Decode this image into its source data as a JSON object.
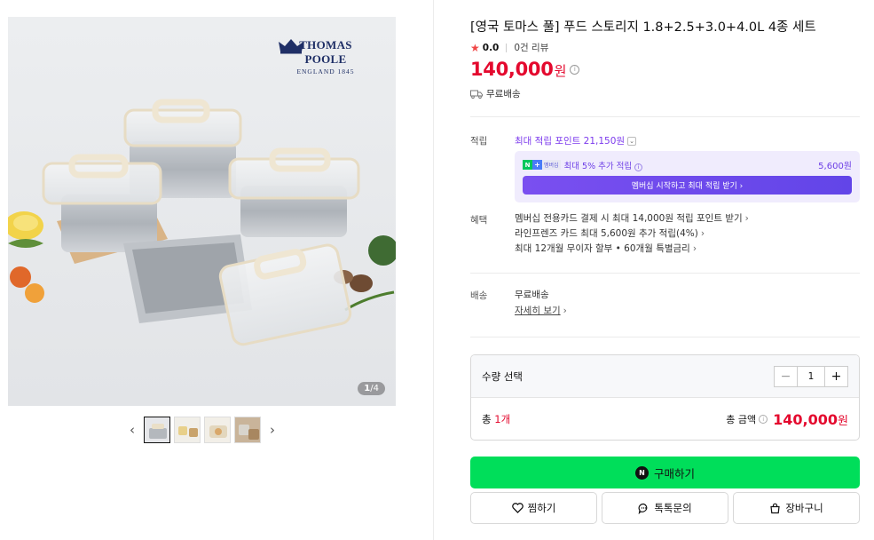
{
  "gallery": {
    "brand_name": "THOMAS POOLE",
    "brand_sub": "ENGLAND 1845",
    "counter_current": "1",
    "counter_total": "/4",
    "prev_icon": "chevron-left-icon",
    "next_icon": "chevron-right-icon",
    "thumbnails": 4,
    "active_thumbnail": 1
  },
  "product": {
    "title": "[영국 토마스 풀] 푸드 스토리지 1.8+2.5+3.0+4.0L 4종 세트",
    "rating": "0.0",
    "review_count": "0건 리뷰",
    "price": "140,000",
    "currency": "원",
    "shipping_top": "무료배송"
  },
  "points": {
    "label": "적립",
    "headline": "최대 적립 포인트 21,150원",
    "promo_text": "최대 5% 추가 적립",
    "promo_badge": "멤버십",
    "promo_amount": "5,600원",
    "promo_button": "멤버십 시작하고 최대 적립 받기 ›"
  },
  "benefits": {
    "label": "혜택",
    "items": [
      "멤버십 전용카드 결제 시 최대 14,000원 적립 포인트 받기",
      "라인프렌즈 카드 최대 5,600원 추가 적립(4%)",
      "최대 12개월 무이자 할부 • 60개월 특별금리"
    ]
  },
  "shipping": {
    "label": "배송",
    "value": "무료배송",
    "detail_link": "자세히 보기"
  },
  "quantity": {
    "label": "수량 선택",
    "value": "1",
    "total_count_prefix": "총 ",
    "total_count": "1개",
    "total_label": "총 금액",
    "total_price": "140,000",
    "total_currency": "원"
  },
  "actions": {
    "buy": "구매하기",
    "wish": "찜하기",
    "talk": "톡톡문의",
    "cart": "장바구니"
  },
  "colors": {
    "price_red": "#e4092e",
    "buy_green": "#00de5a",
    "points_purple": "#7c3aed",
    "brand_navy": "#1f2f66"
  }
}
